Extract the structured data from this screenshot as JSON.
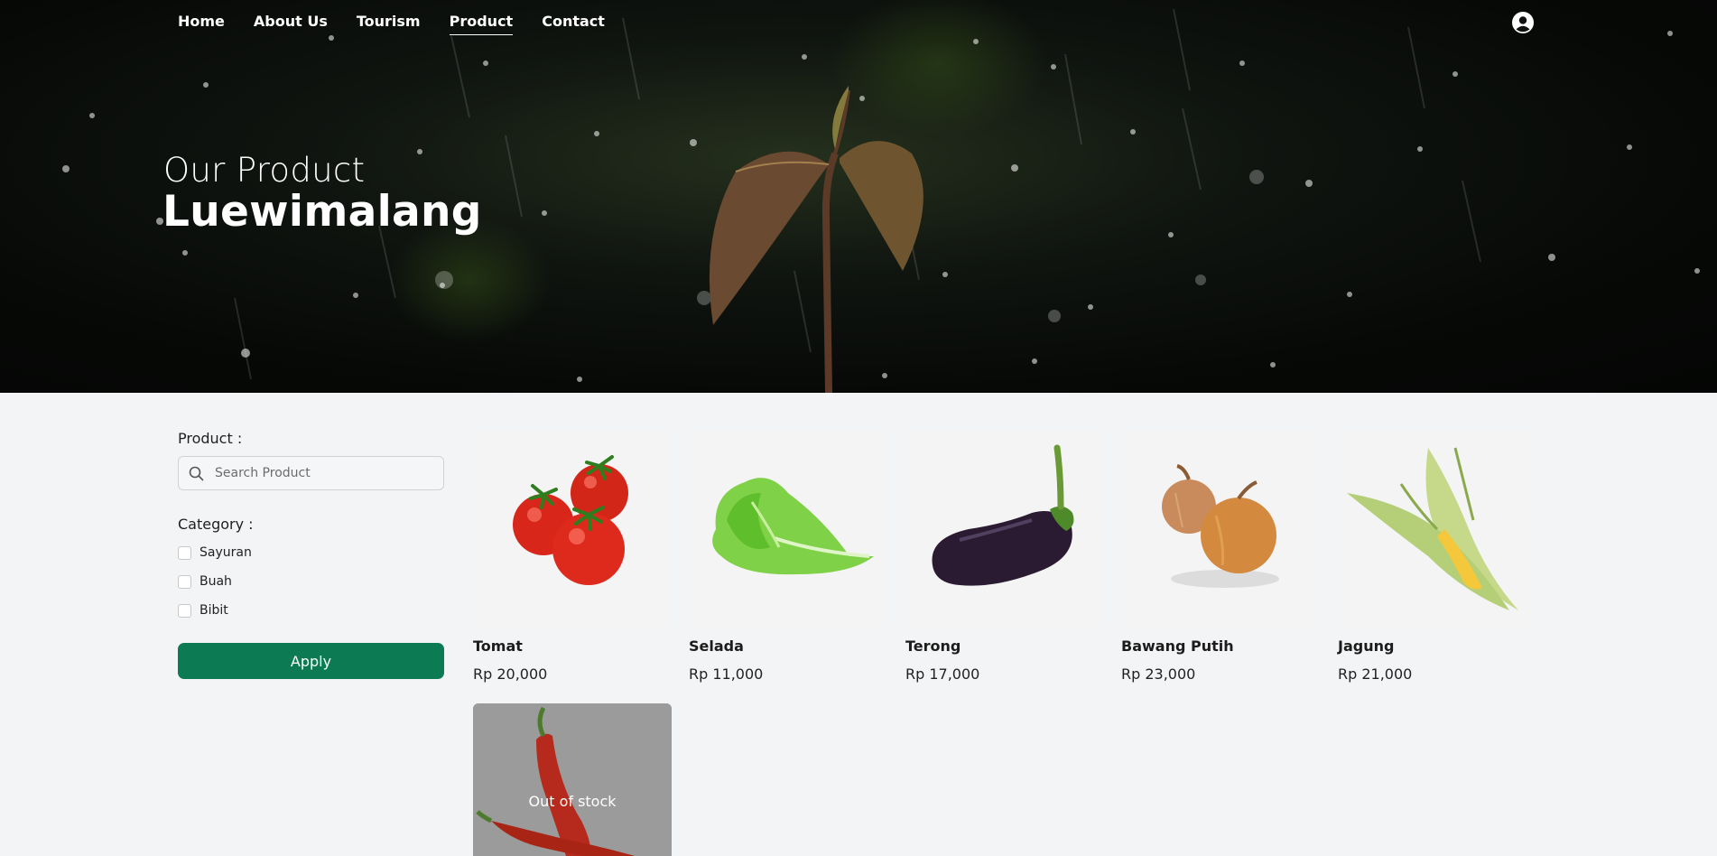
{
  "nav": {
    "items": [
      {
        "label": "Home"
      },
      {
        "label": "About Us"
      },
      {
        "label": "Tourism"
      },
      {
        "label": "Product",
        "active": true
      },
      {
        "label": "Contact"
      }
    ],
    "user_icon": "user-circle-icon"
  },
  "hero": {
    "subtitle": "Our Product",
    "title": "Luewimalang"
  },
  "filters": {
    "product_label": "Product :",
    "search_placeholder": "Search Product",
    "search_value": "",
    "search_icon": "search-icon",
    "category_label": "Category :",
    "categories": [
      {
        "label": "Sayuran",
        "checked": false
      },
      {
        "label": "Buah",
        "checked": false
      },
      {
        "label": "Bibit",
        "checked": false
      }
    ],
    "apply_label": "Apply"
  },
  "products": [
    {
      "name": "Tomat",
      "price": "Rp 20,000",
      "image": "tomato"
    },
    {
      "name": "Selada",
      "price": "Rp 11,000",
      "image": "lettuce"
    },
    {
      "name": "Terong",
      "price": "Rp 17,000",
      "image": "eggplant"
    },
    {
      "name": "Bawang Putih",
      "price": "Rp 23,000",
      "image": "onion"
    },
    {
      "name": "Jagung",
      "price": "Rp 21,000",
      "image": "corn"
    }
  ],
  "out_of_stock": {
    "label": "Out of stock",
    "image": "chili"
  },
  "colors": {
    "accent": "#0c7a52",
    "background": "#f3f4f6"
  }
}
